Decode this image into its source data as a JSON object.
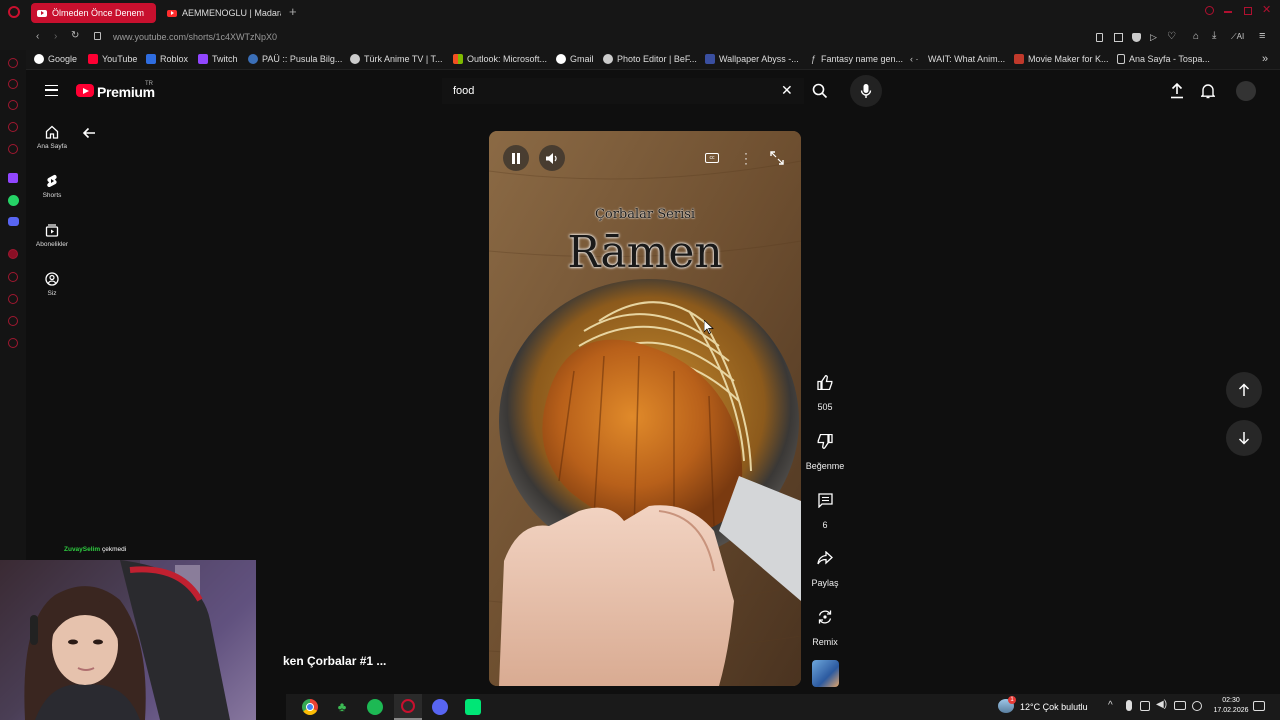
{
  "browser": {
    "tabs": [
      {
        "label": "Ölmeden Önce Denem",
        "active": true
      },
      {
        "label": "AEMMENOGLU | Madara",
        "active": false
      }
    ],
    "url": "www.youtube.com/shorts/1c4XWTzNpX0",
    "bookmarks": [
      {
        "label": "Google",
        "icon": "google-icon"
      },
      {
        "label": "YouTube",
        "icon": "youtube-icon"
      },
      {
        "label": "Roblox",
        "icon": "roblox-icon"
      },
      {
        "label": "Twitch",
        "icon": "twitch-icon"
      },
      {
        "label": "PAÜ :: Pusula Bilg...",
        "icon": "pau-icon"
      },
      {
        "label": "Türk Anime TV | T...",
        "icon": "anime-icon"
      },
      {
        "label": "Outlook: Microsoft...",
        "icon": "outlook-icon"
      },
      {
        "label": "Gmail",
        "icon": "gmail-icon"
      },
      {
        "label": "Photo Editor | BeF...",
        "icon": "photo-editor-icon"
      },
      {
        "label": "Wallpaper Abyss -...",
        "icon": "wallpaper-icon"
      },
      {
        "label": "Fantasy name gen...",
        "icon": "fantasy-icon"
      },
      {
        "label": "WAIT: What Anim...",
        "icon": "wait-icon"
      },
      {
        "label": "Movie Maker for K...",
        "icon": "movie-icon"
      },
      {
        "label": "Ana Sayfa - Tospa...",
        "icon": "page-icon"
      }
    ],
    "ai_label": "AI"
  },
  "youtube": {
    "logo": "Premium",
    "region": "TR",
    "search_value": "food",
    "nav": [
      {
        "label": "Ana Sayfa",
        "icon": "home-icon"
      },
      {
        "label": "Shorts",
        "icon": "shorts-icon"
      },
      {
        "label": "Abonelikler",
        "icon": "subscriptions-icon"
      },
      {
        "label": "Siz",
        "icon": "you-icon"
      }
    ],
    "video": {
      "overlay_small": "Çorbalar Serisi",
      "overlay_large": "Rāmen"
    },
    "actions": {
      "like_count": "505",
      "dislike_label": "Beğenme",
      "comment_count": "6",
      "share_label": "Paylaş",
      "remix_label": "Remix"
    },
    "short_title": "ken Çorbalar #1 ..."
  },
  "stream": {
    "chat_user": "ZuvaySelim",
    "chat_message": "çekmedi"
  },
  "taskbar": {
    "weather": "12°C  Çok bulutlu",
    "weather_badge": "1",
    "time": "02:30",
    "date": "17.02.2026"
  },
  "colors": {
    "yt_red": "#ff0033",
    "opera_red": "#c8102e",
    "bg": "#0f0f0f"
  }
}
